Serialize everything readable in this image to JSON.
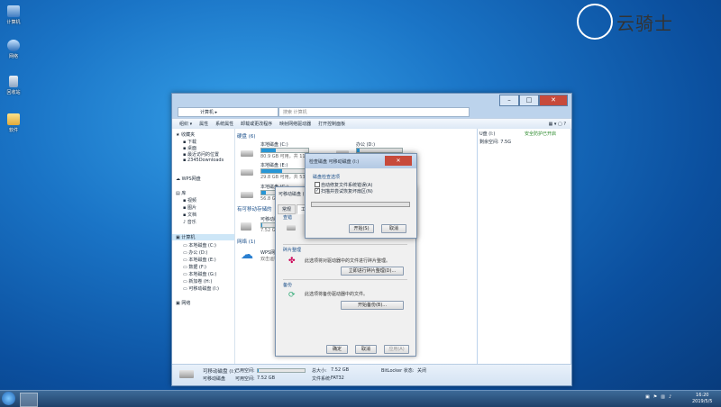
{
  "desktop": {
    "icons": [
      {
        "label": "计算机"
      },
      {
        "label": "网络"
      },
      {
        "label": "回收站"
      },
      {
        "label": "软件"
      }
    ],
    "logo_text": "云骑士"
  },
  "explorer": {
    "address": "计算机 ▸",
    "search_placeholder": "搜索 计算机",
    "toolbar": [
      "组织 ▾",
      "属性",
      "系统属性",
      "卸载或更改程序",
      "映射网络驱动器",
      "打开控制面板"
    ],
    "nav": [
      "收藏夹",
      "下载",
      "桌面",
      "最近访问的位置",
      "2345Downloads",
      "WPS网盘",
      "库",
      "视频",
      "图片",
      "文档",
      "音乐",
      "计算机",
      "本地磁盘 (C:)",
      "办公 (D:)",
      "本地磁盘 (E:)",
      "数据 (F:)",
      "本地磁盘 (G:)",
      "新加卷 (H:)",
      "可移动磁盘 (I:)",
      "网络"
    ],
    "group_hdd": "硬盘 (6)",
    "group_removable": "有可移动存储的",
    "group_network": "网络 (1)",
    "drives": [
      {
        "name": "本地磁盘 (C:)",
        "free": "80.9 GB 可用，共 110 GB",
        "fill": 0.3
      },
      {
        "name": "办公 (D:)",
        "fill": 0.05
      },
      {
        "name": "本地磁盘 (E:)",
        "free": "29.8 GB 可用，共 53",
        "fill": 0.45
      },
      {
        "name": "本地磁盘 (G:)",
        "free": "56.8 GB 可用",
        "fill": 0.1
      }
    ],
    "removable_name": "可移动磁盘",
    "removable_free": "7.52 GB",
    "network_item": "WPS网盘",
    "network_sub": "双击运行WPS",
    "right_pane": {
      "drive": "U盘 (I:)",
      "free": "剩余空间: 7.5G",
      "safe": "安全防护已开启"
    },
    "details": {
      "name": "可移动磁盘 (I:)",
      "type": "可移动磁盘",
      "used_label": "已用空间:",
      "free_label": "可用空间:",
      "free_value": "7.52 GB",
      "total_label": "总大小:",
      "total_value": "7.52 GB",
      "fs_label": "文件系统:",
      "fs_value": "FAT32",
      "bitlocker_label": "BitLocker 状态:",
      "bitlocker_value": "关闭"
    }
  },
  "properties": {
    "title": "可移动磁盘 (I:) 属性",
    "tabs": [
      "常规",
      "工具",
      "硬件",
      "共享",
      "ReadyBoost",
      "自定义"
    ],
    "section_check": "查错",
    "section_defrag": "碎片整理",
    "defrag_text": "此选项将对驱动器中的文件进行碎片整理。",
    "defrag_button": "立即进行碎片整理(D)...",
    "section_backup": "备份",
    "backup_text": "此选项将备份驱动器中的文件。",
    "backup_button": "开始备份(B)...",
    "ok": "确定",
    "cancel": "取消",
    "apply": "应用(A)"
  },
  "check_dialog": {
    "title": "检查磁盘 可移动磁盘 (I:)",
    "close": "✕",
    "group": "磁盘检查选项",
    "opt1": "自动修复文件系统错误(A)",
    "opt2": "扫描并尝试恢复坏扇区(N)",
    "start": "开始(S)",
    "cancel": "取消",
    "progress": 0.0
  },
  "taskbar": {
    "time": "16:20",
    "date": "2019/5/5"
  }
}
